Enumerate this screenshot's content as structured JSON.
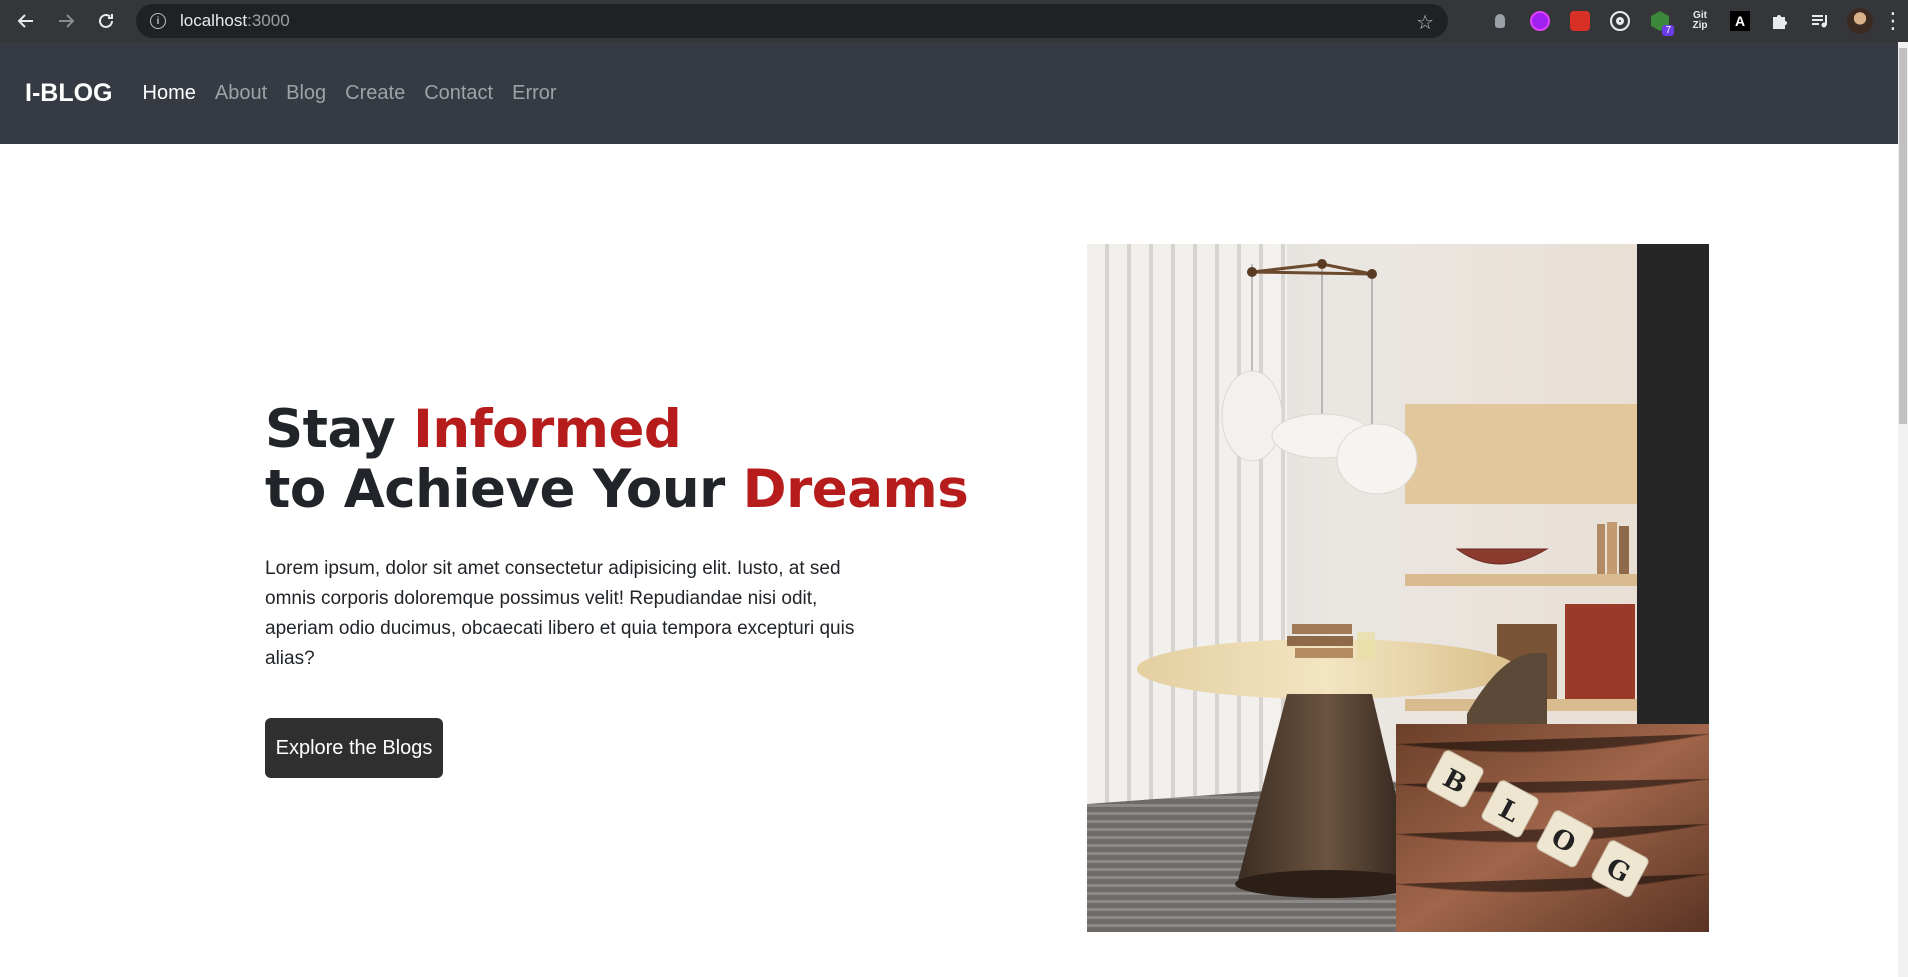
{
  "browser": {
    "url_host": "localhost",
    "url_port": ":3000",
    "back_icon": "arrow-left-icon",
    "forward_icon": "arrow-right-icon",
    "reload_icon": "reload-icon",
    "extension_badge": "7",
    "gitzip_label_top": "Git",
    "gitzip_label_bottom": "Zip",
    "ext_a_label": "A"
  },
  "navbar": {
    "brand": "I-BLOG",
    "links": [
      {
        "label": "Home",
        "active": true
      },
      {
        "label": "About",
        "active": false
      },
      {
        "label": "Blog",
        "active": false
      },
      {
        "label": "Create",
        "active": false
      },
      {
        "label": "Contact",
        "active": false
      },
      {
        "label": "Error",
        "active": false
      }
    ]
  },
  "hero": {
    "title_line1_a": "Stay ",
    "title_line1_b": "Informed",
    "title_line2_a": "to Achieve Your ",
    "title_line2_b": "Dreams",
    "paragraph": "Lorem ipsum, dolor sit amet consectetur adipisicing elit. Iusto, at sed omnis corporis doloremque possimus velit! Repudiandae nisi odit, aperiam odio ducimus, obcaecati libero et quia tempora excepturi quis alias?",
    "cta_label": "Explore the Blogs"
  },
  "images": {
    "main_tile_letters": [
      "B",
      "L",
      "O",
      "G"
    ]
  },
  "colors": {
    "navbar_bg": "#363a42",
    "accent_red": "#b71c1c",
    "button_bg": "#2f2f2f"
  }
}
